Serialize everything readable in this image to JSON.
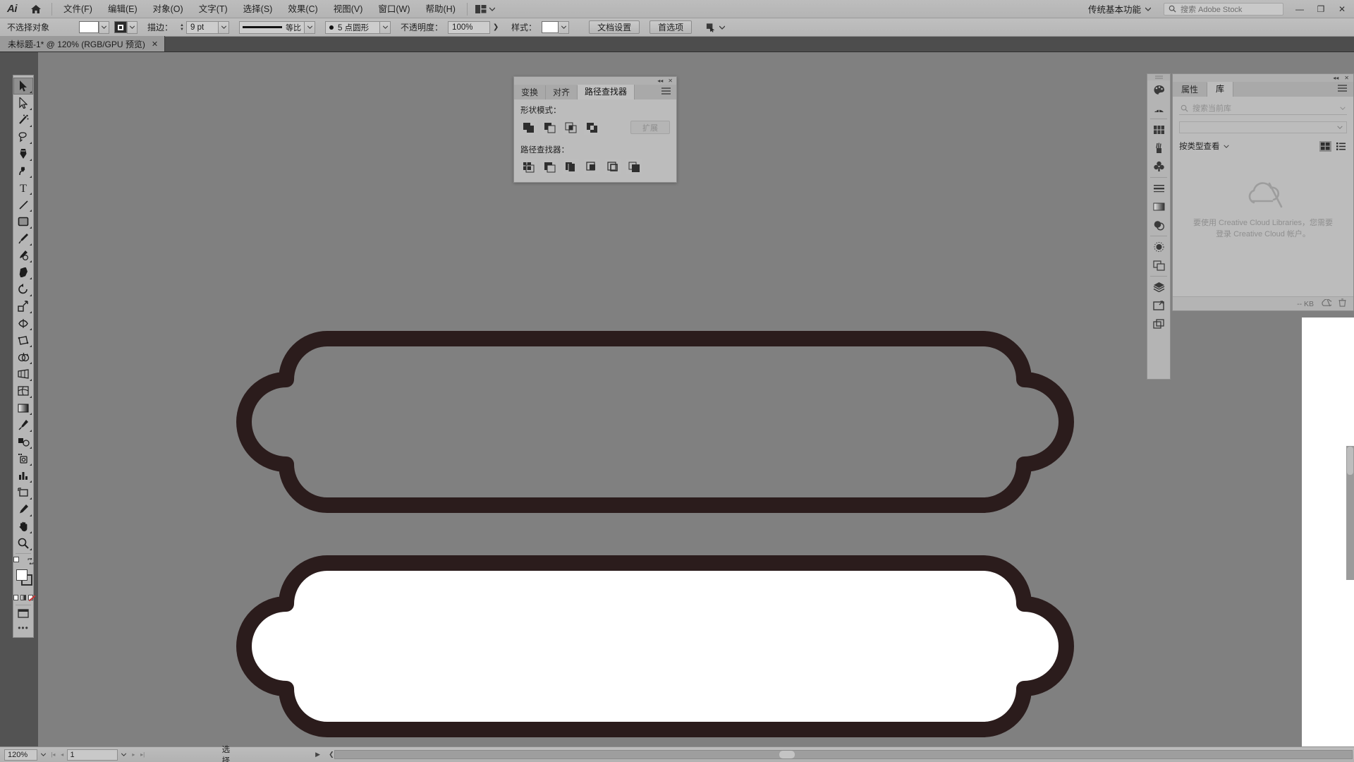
{
  "app": {
    "name": "Adobe Illustrator",
    "logo": "Ai",
    "workspace": "传统基本功能",
    "search_placeholder": "搜索 Adobe Stock"
  },
  "menubar": {
    "items": [
      {
        "label": "文件(F)",
        "name": "menu-file"
      },
      {
        "label": "编辑(E)",
        "name": "menu-edit"
      },
      {
        "label": "对象(O)",
        "name": "menu-object"
      },
      {
        "label": "文字(T)",
        "name": "menu-type"
      },
      {
        "label": "选择(S)",
        "name": "menu-select"
      },
      {
        "label": "效果(C)",
        "name": "menu-effect"
      },
      {
        "label": "视图(V)",
        "name": "menu-view"
      },
      {
        "label": "窗口(W)",
        "name": "menu-window"
      },
      {
        "label": "帮助(H)",
        "name": "menu-help"
      }
    ],
    "window_buttons": {
      "minimize": "—",
      "restore": "❐",
      "close": "✕"
    }
  },
  "controlbar": {
    "selection_status": "不选择对象",
    "fill_color": "#ffffff",
    "stroke_color": "#2b2b2b",
    "stroke_label": "描边：",
    "stroke_weight": "9 pt",
    "stroke_profile": "等比",
    "brush_definition": "5 点圆形",
    "opacity_label": "不透明度：",
    "opacity_value": "100%",
    "style_label": "样式：",
    "document_setup": "文档设置",
    "preferences": "首选项"
  },
  "document_tab": {
    "title": "未标题-1* @ 120% (RGB/GPU 预览)",
    "close": "✕"
  },
  "toolbar": {
    "tools": [
      {
        "name": "selection-tool",
        "label": "选择工具",
        "active": true
      },
      {
        "name": "direct-selection-tool",
        "label": "直接选择工具",
        "active": false
      },
      {
        "name": "magic-wand-tool",
        "label": "魔棒工具",
        "active": false
      },
      {
        "name": "lasso-tool",
        "label": "套索工具",
        "active": false
      },
      {
        "name": "pen-tool",
        "label": "钢笔工具",
        "active": false
      },
      {
        "name": "curvature-tool",
        "label": "曲率工具",
        "active": false
      },
      {
        "name": "type-tool",
        "label": "文字工具",
        "active": false
      },
      {
        "name": "line-segment-tool",
        "label": "直线段工具",
        "active": false
      },
      {
        "name": "rectangle-tool",
        "label": "矩形工具",
        "active": false
      },
      {
        "name": "paintbrush-tool",
        "label": "画笔工具",
        "active": false
      },
      {
        "name": "shaper-tool",
        "label": "Shaper 工具",
        "active": false
      },
      {
        "name": "eraser-tool",
        "label": "橡皮擦工具",
        "active": false
      },
      {
        "name": "rotate-tool",
        "label": "旋转工具",
        "active": false
      },
      {
        "name": "scale-tool",
        "label": "比例缩放工具",
        "active": false
      },
      {
        "name": "width-tool",
        "label": "宽度工具",
        "active": false
      },
      {
        "name": "free-transform-tool",
        "label": "自由变换工具",
        "active": false
      },
      {
        "name": "shape-builder-tool",
        "label": "形状生成器工具",
        "active": false
      },
      {
        "name": "perspective-grid-tool",
        "label": "透视网格工具",
        "active": false
      },
      {
        "name": "mesh-tool",
        "label": "网格工具",
        "active": false
      },
      {
        "name": "gradient-tool",
        "label": "渐变工具",
        "active": false
      },
      {
        "name": "eyedropper-tool",
        "label": "吸管工具",
        "active": false
      },
      {
        "name": "blend-tool",
        "label": "混合工具",
        "active": false
      },
      {
        "name": "symbol-sprayer-tool",
        "label": "符号喷枪工具",
        "active": false
      },
      {
        "name": "column-graph-tool",
        "label": "柱形图工具",
        "active": false
      },
      {
        "name": "artboard-tool",
        "label": "画板工具",
        "active": false
      },
      {
        "name": "slice-tool",
        "label": "切片工具",
        "active": false
      },
      {
        "name": "hand-tool",
        "label": "抓手工具",
        "active": false
      },
      {
        "name": "zoom-tool",
        "label": "缩放工具",
        "active": false
      }
    ],
    "fill_color": "#ffffff",
    "stroke_color": "#2e2e2e",
    "more_tools": "•••"
  },
  "pathfinder_panel": {
    "tabs": [
      {
        "label": "变换",
        "selected": false
      },
      {
        "label": "对齐",
        "selected": false
      },
      {
        "label": "路径查找器",
        "selected": true
      }
    ],
    "menu_icon": "panel-menu-icon",
    "shape_modes_label": "形状模式：",
    "shape_modes": [
      {
        "name": "unite-button",
        "label": "联集"
      },
      {
        "name": "minus-front-button",
        "label": "减去顶层"
      },
      {
        "name": "intersect-button",
        "label": "交集"
      },
      {
        "name": "exclude-button",
        "label": "差集"
      }
    ],
    "expand_button": "扩展",
    "pathfinders_label": "路径查找器：",
    "pathfinders": [
      {
        "name": "divide-button",
        "label": "分割"
      },
      {
        "name": "trim-button",
        "label": "修边"
      },
      {
        "name": "merge-button",
        "label": "合并"
      },
      {
        "name": "crop-button",
        "label": "裁剪"
      },
      {
        "name": "outline-button",
        "label": "轮廓"
      },
      {
        "name": "minus-back-button",
        "label": "减去后方对象"
      }
    ]
  },
  "dock_strip": {
    "icons": [
      {
        "name": "color-icon",
        "label": "颜色"
      },
      {
        "name": "color-guide-icon",
        "label": "颜色参考"
      },
      {
        "name": "swatches-icon",
        "label": "色板"
      },
      {
        "name": "brushes-icon",
        "label": "画笔"
      },
      {
        "name": "symbols-icon",
        "label": "符号"
      },
      {
        "name": "stroke-icon",
        "label": "描边"
      },
      {
        "name": "gradient-icon",
        "label": "渐变"
      },
      {
        "name": "transparency-icon",
        "label": "透明度"
      },
      {
        "name": "appearance-icon",
        "label": "外观"
      },
      {
        "name": "graphic-styles-icon",
        "label": "图形样式"
      },
      {
        "name": "layers-icon",
        "label": "图层"
      },
      {
        "name": "artboards-icon",
        "label": "画板"
      },
      {
        "name": "asset-export-icon",
        "label": "资源导出"
      }
    ]
  },
  "right_panel": {
    "tabs": [
      {
        "label": "属性",
        "selected": false
      },
      {
        "label": "库",
        "selected": true
      }
    ],
    "search_placeholder": "搜索当前库",
    "library_select": "",
    "view_label": "按类型查看",
    "empty_message": "要使用 Creative Cloud Libraries，您需要登录 Creative Cloud 帐户。",
    "footer_size": "-- KB"
  },
  "statusbar": {
    "zoom": "120%",
    "page": "1",
    "tool_status": "选择"
  },
  "artwork": {
    "stroke_color": "#2b1c1c",
    "canvas_color": "#808080",
    "shapes": [
      {
        "name": "cloud-banner-outline",
        "fill": "none",
        "stroke": "#2b1c1c",
        "stroke_width": 22
      },
      {
        "name": "cloud-banner-filled",
        "fill": "#ffffff",
        "stroke": "#2b1c1c",
        "stroke_width": 22
      }
    ]
  }
}
